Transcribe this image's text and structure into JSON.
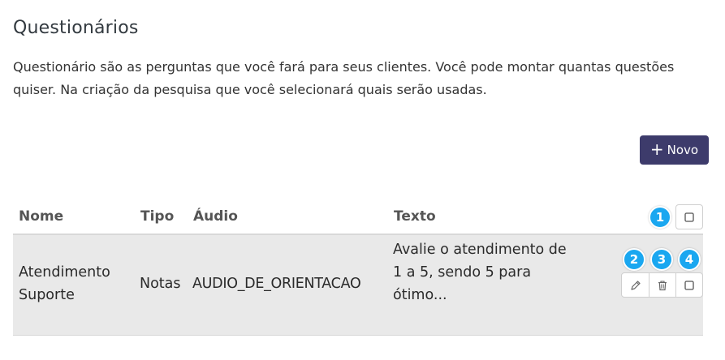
{
  "page": {
    "title": "Questionários",
    "description": "Questionário são as perguntas que você fará para seus clientes. Você pode montar quantas questões quiser. Na criação da pesquisa que você selecionará quais serão usadas."
  },
  "toolbar": {
    "new_label": "Novo",
    "new_icon": "plus-icon"
  },
  "table": {
    "columns": [
      "Nome",
      "Tipo",
      "Áudio",
      "Texto"
    ],
    "rows": [
      {
        "nome": "Atendimento Suporte",
        "tipo": "Notas",
        "audio": "AUDIO_DE_ORIENTACAO",
        "texto": "Avalie o atendimento de 1 a 5, sendo 5 para ótimo..."
      }
    ]
  },
  "badges": [
    "1",
    "2",
    "3",
    "4"
  ],
  "colors": {
    "primary_button": "#3d3b6b",
    "badge": "#1aa7f0",
    "row_bg": "#e9e9e9"
  }
}
